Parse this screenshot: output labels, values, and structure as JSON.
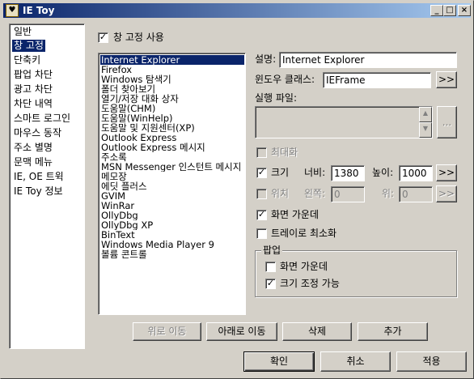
{
  "window": {
    "title": "IE Toy",
    "icon_glyph": "♥",
    "minimize": "_",
    "maximize": "□",
    "close": "×"
  },
  "nav": {
    "items": [
      {
        "label": "일반"
      },
      {
        "label": "창 고정"
      },
      {
        "label": "단축키"
      },
      {
        "label": "팝업 차단"
      },
      {
        "label": "광고 차단"
      },
      {
        "label": "차단 내역"
      },
      {
        "label": "스마트 로그인"
      },
      {
        "label": "마우스 동작"
      },
      {
        "label": "주소 별명"
      },
      {
        "label": "문맥 메뉴"
      },
      {
        "label": "IE, OE 트윅"
      },
      {
        "label": "IE Toy 정보"
      }
    ],
    "selected_index": 1
  },
  "fix_window": {
    "use_label": "창 고정 사용",
    "use_checked": true
  },
  "program_list": {
    "items": [
      "Internet Explorer",
      "Firefox",
      "Windows 탐색기",
      "폴더 찾아보기",
      "열기/저장 대화 상자",
      "도움말(CHM)",
      "도움말(WinHelp)",
      "도움말 및 지원센터(XP)",
      "Outlook Express",
      "Outlook Express 메시지",
      "주소록",
      "MSN Messenger 인스턴트 메시지",
      "메모장",
      "에딧 플러스",
      "GVIM",
      "WinRar",
      "OllyDbg",
      "OllyDbg XP",
      "BinText",
      "Windows Media Player 9",
      "볼륨 콘트롤"
    ],
    "selected_index": 0
  },
  "details": {
    "desc_label": "설명:",
    "desc_value": "Internet Explorer",
    "class_label": "윈도우 클래스:",
    "class_value": "IEFrame",
    "class_browse": ">>",
    "exe_label": "실행 파일:",
    "exe_browse": "...",
    "maximize_label": "최대화",
    "size_label": "크기",
    "size_checked": true,
    "width_label": "너비:",
    "width_value": "1380",
    "height_label": "높이:",
    "height_value": "1000",
    "size_browse": ">>",
    "position_label": "위치",
    "left_label": "왼쪽:",
    "left_value": "0",
    "top_label": "위:",
    "top_value": "0",
    "position_browse": ">>",
    "center_label": "화면 가운데",
    "center_checked": true,
    "tray_label": "트레이로 최소화",
    "tray_checked": false
  },
  "popup_group": {
    "title": "팝업",
    "center_label": "화면 가운데",
    "center_checked": false,
    "resizable_label": "크기 조정 가능",
    "resizable_checked": true
  },
  "list_buttons": {
    "move_up": "위로 이동",
    "move_down": "아래로 이동",
    "delete": "삭제",
    "add": "추가"
  },
  "dialog_buttons": {
    "ok": "확인",
    "cancel": "취소",
    "apply": "적용"
  }
}
